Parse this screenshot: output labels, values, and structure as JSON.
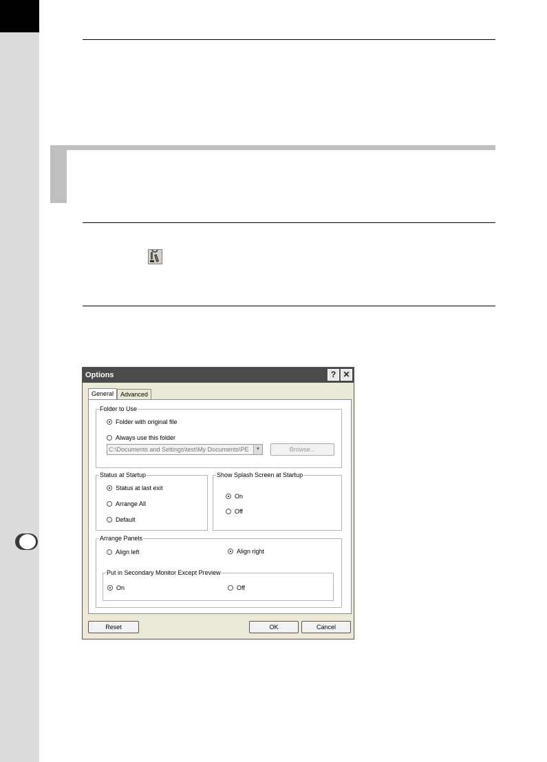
{
  "dialog": {
    "title": "Options",
    "help_button": "?",
    "close_button": "✕",
    "tabs": [
      {
        "label": "General",
        "active": true
      },
      {
        "label": "Advanced",
        "active": false
      }
    ],
    "folder_group": {
      "title": "Folder to Use",
      "options": [
        {
          "label": "Folder with original file",
          "selected": true
        },
        {
          "label": "Always use this folder",
          "selected": false
        }
      ],
      "path_value": "C:\\Documents and Settings\\test\\My Documents\\PE",
      "browse_label": "Browse..."
    },
    "startup_group": {
      "title": "Status at Startup",
      "options": [
        {
          "label": "Status at last exit",
          "selected": true
        },
        {
          "label": "Arrange All",
          "selected": false
        },
        {
          "label": "Default",
          "selected": false
        }
      ]
    },
    "splash_group": {
      "title": "Show Splash Screen at Startup",
      "options": [
        {
          "label": "On",
          "selected": true
        },
        {
          "label": "Off",
          "selected": false
        }
      ]
    },
    "arrange_group": {
      "title": "Arrange Panels",
      "options": [
        {
          "label": "Align left",
          "selected": false
        },
        {
          "label": "Align right",
          "selected": true
        }
      ],
      "secondary_group": {
        "title": "Put in Secondary Monitor Except Preview",
        "options": [
          {
            "label": "On",
            "selected": true
          },
          {
            "label": "Off",
            "selected": false
          }
        ]
      }
    },
    "buttons": {
      "reset": "Reset",
      "ok": "OK",
      "cancel": "Cancel"
    }
  },
  "colors": {
    "titlebar": "#4a4a4a",
    "dialog_bg": "#ece9d8",
    "side_strip": "#dcdcdc"
  },
  "icons": {
    "toolbar_icon": "options-wrench-icon"
  }
}
